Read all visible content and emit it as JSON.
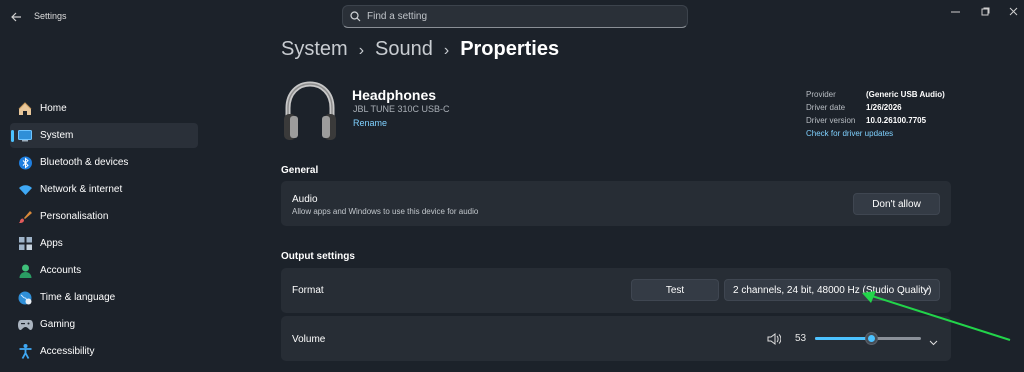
{
  "window": {
    "title": "Settings",
    "back_icon": "back-arrow-icon",
    "controls": [
      "minimize",
      "maximize",
      "close"
    ]
  },
  "search": {
    "placeholder": "Find a setting",
    "value": ""
  },
  "sidebar": {
    "items": [
      {
        "label": "Home",
        "icon": "home-icon",
        "selected": false
      },
      {
        "label": "System",
        "icon": "system-icon",
        "selected": true
      },
      {
        "label": "Bluetooth & devices",
        "icon": "bluetooth-icon",
        "selected": false
      },
      {
        "label": "Network & internet",
        "icon": "wifi-icon",
        "selected": false
      },
      {
        "label": "Personalisation",
        "icon": "brush-icon",
        "selected": false
      },
      {
        "label": "Apps",
        "icon": "apps-icon",
        "selected": false
      },
      {
        "label": "Accounts",
        "icon": "accounts-icon",
        "selected": false
      },
      {
        "label": "Time & language",
        "icon": "globe-icon",
        "selected": false
      },
      {
        "label": "Gaming",
        "icon": "gamepad-icon",
        "selected": false
      },
      {
        "label": "Accessibility",
        "icon": "accessibility-icon",
        "selected": false
      }
    ]
  },
  "breadcrumb": {
    "items": [
      "System",
      "Sound",
      "Properties"
    ],
    "separator": "›"
  },
  "device": {
    "name": "Headphones",
    "model": "JBL TUNE 310C USB-C",
    "rename_label": "Rename",
    "icon": "headphones-icon",
    "info": [
      {
        "key": "Provider",
        "value": "(Generic USB Audio)"
      },
      {
        "key": "Driver date",
        "value": "1/26/2026"
      },
      {
        "key": "Driver version",
        "value": "10.0.26100.7705"
      }
    ],
    "check_updates_label": "Check for driver updates"
  },
  "general": {
    "title": "General",
    "audio": {
      "title": "Audio",
      "description": "Allow apps and Windows to use this device for audio",
      "button_label": "Don't allow"
    }
  },
  "output": {
    "title": "Output settings",
    "format": {
      "label": "Format",
      "test_label": "Test",
      "selected": "2 channels, 24 bit, 48000 Hz (Studio Quality)"
    },
    "volume": {
      "label": "Volume",
      "value": "53",
      "fraction": 0.53
    }
  },
  "colors": {
    "accent": "#4cc2ff",
    "background": "#1c222a",
    "card": "#272d35",
    "annotation_arrow": "#22d44a"
  }
}
